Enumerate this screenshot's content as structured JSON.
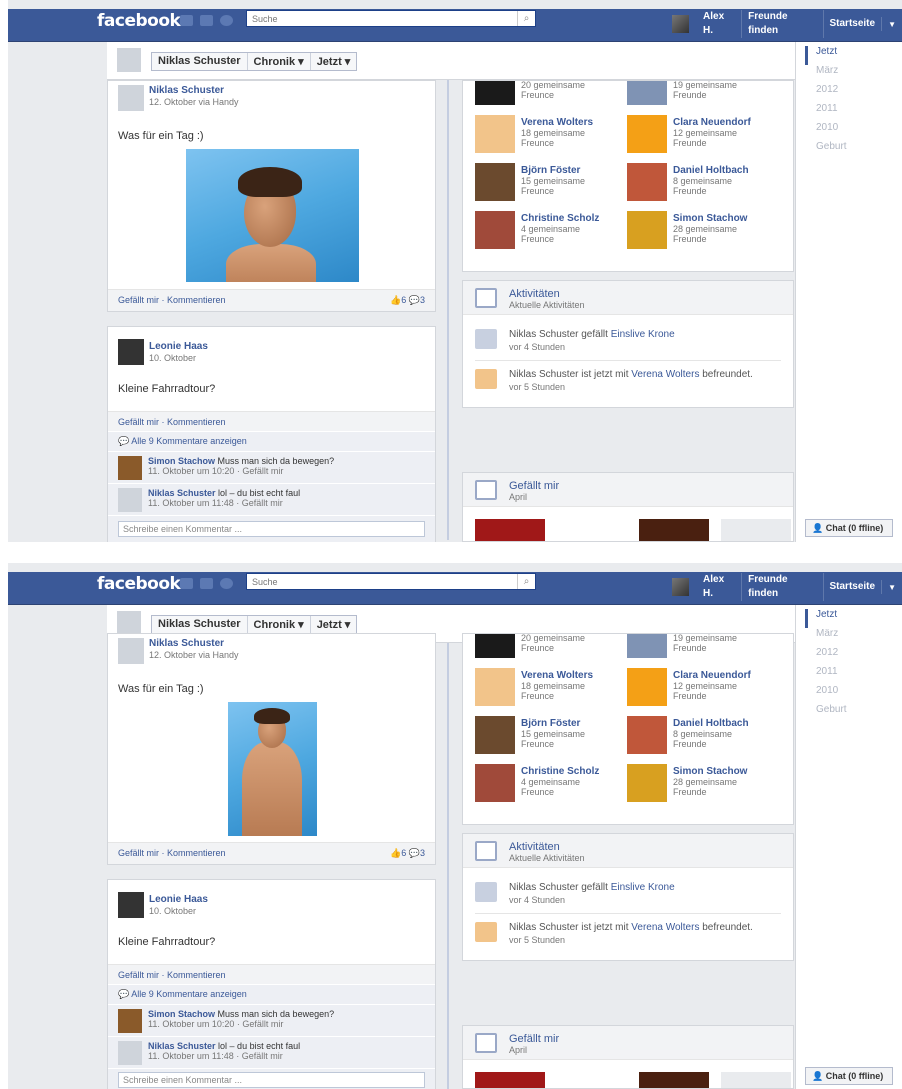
{
  "header": {
    "logo": "facebook",
    "search_placeholder": "Suche",
    "user_name": "Alex H.",
    "find_friends": "Freunde finden",
    "home": "Startseite"
  },
  "profile_bar": {
    "name": "Niklas Schuster",
    "chronik": "Chronik ▾",
    "jetzt": "Jetzt ▾"
  },
  "timeline_nav": [
    "Jetzt",
    "März",
    "2012",
    "2011",
    "2010",
    "Geburt"
  ],
  "post1": {
    "author": "Niklas Schuster",
    "meta": "12. Oktober via Handy",
    "text": "Was für ein Tag :)",
    "actions": "Gefällt mir · Kommentieren",
    "likes": "6",
    "comments": "3"
  },
  "post2": {
    "author": "Leonie Haas",
    "meta": "10. Oktober",
    "text": "Kleine Fahrradtour?",
    "actions": "Gefällt mir · Kommentieren",
    "show_all": "Alle 9 Kommentare anzeigen",
    "comments": [
      {
        "name": "Simon Stachow",
        "text": "Muss man sich da bewegen?",
        "meta": "11. Oktober um 10:20 · Gefällt mir"
      },
      {
        "name": "Niklas Schuster",
        "text": "lol – du bist echt faul",
        "meta": "11. Oktober um 11:48 · Gefällt mir"
      }
    ],
    "write_placeholder": "Schreibe einen Kommentar ..."
  },
  "friends": {
    "top_left_sub": "20 gemeinsame Freunce",
    "top_right_sub": "19 gemeinsame Freunde",
    "items": [
      {
        "name": "Verena Wolters",
        "sub": "18 gemeinsame Freunce"
      },
      {
        "name": "Clara Neuendorf",
        "sub": "12 gemeinsame Freunde"
      },
      {
        "name": "Björn Föster",
        "sub": "15 gemeinsame Freunce"
      },
      {
        "name": "Daniel Holtbach",
        "sub": "8 gemeinsame Freunde"
      },
      {
        "name": "Christine Scholz",
        "sub": "4 gemeinsame Freunce"
      },
      {
        "name": "Simon Stachow",
        "sub": "28 gemeinsame Freunde"
      }
    ]
  },
  "activities": {
    "title": "Aktivitäten",
    "subtitle": "Aktuelle Aktivitäten",
    "a1_pre": "Niklas Schuster gefällt ",
    "a1_link": "Einslive Krone",
    "a1_time": "vor 4 Stunden",
    "a2_pre": "Niklas Schuster ist jetzt mit ",
    "a2_link": "Verena Wolters",
    "a2_post": " befreundet.",
    "a2_time": "vor 5 Stunden"
  },
  "likes_panel": {
    "title": "Gefällt mir",
    "subtitle": "April"
  },
  "chat": {
    "label": "Chat (0 ffline)"
  },
  "colors": {
    "brand": "#3b5998",
    "background": "#e9ebee"
  }
}
